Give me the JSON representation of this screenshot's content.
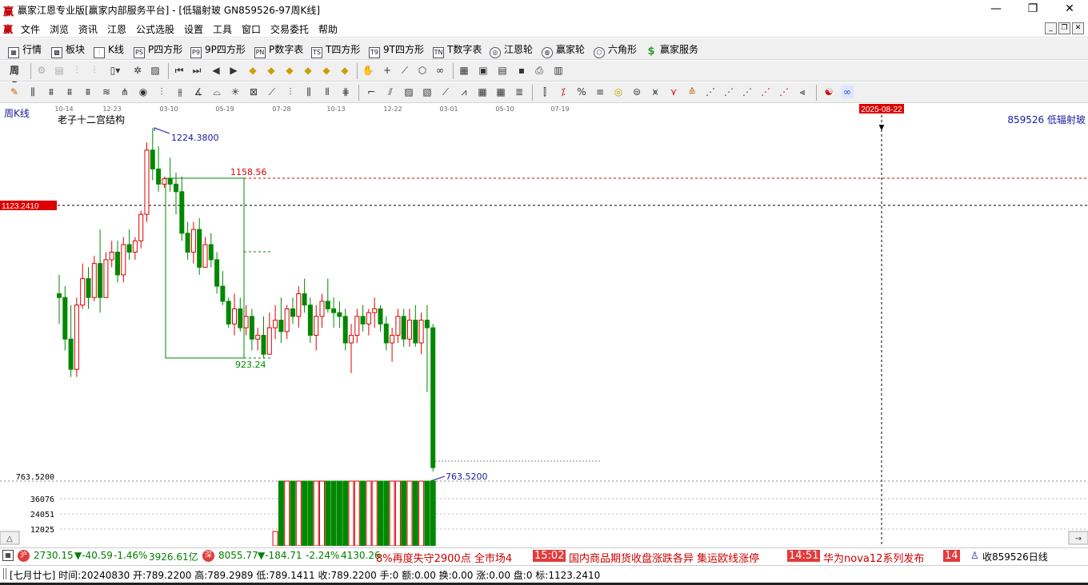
{
  "window": {
    "logo_char": "赢",
    "title": "赢家江恩专业版[赢家内部服务平台] - [低辐射玻  GN859526-97周K线]",
    "minimize": "—",
    "maximize": "❐",
    "close": "✕"
  },
  "menu": {
    "logo_char": "赢",
    "items": [
      "文件",
      "浏览",
      "资讯",
      "江恩",
      "公式选股",
      "设置",
      "工具",
      "窗口",
      "交易委托",
      "帮助"
    ]
  },
  "toolbar1": {
    "items": [
      {
        "icon": "grid-icon",
        "glyph": "▦",
        "label": "行情"
      },
      {
        "icon": "blocks-icon",
        "glyph": "▩",
        "label": "板块"
      },
      {
        "icon": "candlestick-icon",
        "glyph": "⫶",
        "label": "K线"
      },
      {
        "icon": "p-square-icon",
        "glyph": "PS",
        "label": "P四方形"
      },
      {
        "icon": "9p-square-icon",
        "glyph": "P9",
        "label": "9P四方形"
      },
      {
        "icon": "p-number-table-icon",
        "glyph": "PN",
        "label": "P数字表"
      },
      {
        "icon": "t-square-icon",
        "glyph": "TS",
        "label": "T四方形"
      },
      {
        "icon": "9t-square-icon",
        "glyph": "T9",
        "label": "9T四方形"
      },
      {
        "icon": "t-number-table-icon",
        "glyph": "TN",
        "label": "T数字表"
      },
      {
        "icon": "gann-wheel-icon",
        "glyph": "◎",
        "label": "江恩轮"
      },
      {
        "icon": "winner-wheel-icon",
        "glyph": "◍",
        "label": "赢家轮"
      },
      {
        "icon": "hexagon-icon",
        "glyph": "⬡",
        "label": "六角形"
      },
      {
        "icon": "dollar-icon",
        "glyph": "$",
        "label": "赢家服务"
      }
    ]
  },
  "chart": {
    "period_label": "周K线",
    "structure_label": "老子十二宫结构",
    "stock_info": "859526  低辐射玻",
    "time_ticks": [
      "10-14",
      "12-23",
      "03-10",
      "05-19",
      "07-28",
      "10-13",
      "12-22",
      "03-01",
      "05-10",
      "07-19"
    ],
    "cursor_date": "2025-08-22",
    "high_label": "1224.3800",
    "box_top_label": "1158.56",
    "box_bottom_label": "923.24",
    "current_price_label": "1123.2410",
    "low_label": "763.5200",
    "axis_low_label": "763.5200",
    "volume_ticks": [
      "36076",
      "24051",
      "12025"
    ],
    "colors": {
      "up": "#dd0000",
      "down": "#008800",
      "box": "#008800",
      "dashed_red": "#dd0000",
      "label_blue": "#1a1aa0"
    }
  },
  "chart_data": {
    "type": "candlestick",
    "title": "老子十二宫结构",
    "period": "周K线",
    "x_tick_labels": [
      "10-14",
      "12-23",
      "03-10",
      "05-19",
      "07-28",
      "10-13",
      "12-22",
      "03-01",
      "05-10",
      "07-19"
    ],
    "annotations": {
      "high": 1224.38,
      "box_top": 1158.56,
      "box_bottom": 923.24,
      "current_price": 1123.241,
      "low": 763.52
    },
    "volume_axis_ticks": [
      36076,
      24051,
      12025
    ],
    "candles": [
      [
        1005,
        1030,
        965,
        1000
      ],
      [
        1000,
        1015,
        930,
        945
      ],
      [
        945,
        990,
        895,
        905
      ],
      [
        905,
        1000,
        895,
        990
      ],
      [
        990,
        1045,
        985,
        1025
      ],
      [
        1025,
        1040,
        985,
        1000
      ],
      [
        1000,
        1055,
        995,
        1045
      ],
      [
        1045,
        1090,
        980,
        1000
      ],
      [
        1000,
        1060,
        1000,
        1050
      ],
      [
        1050,
        1075,
        1040,
        1060
      ],
      [
        1060,
        1075,
        1020,
        1030
      ],
      [
        1030,
        1080,
        1020,
        1070
      ],
      [
        1070,
        1090,
        1050,
        1060
      ],
      [
        1060,
        1080,
        1050,
        1075
      ],
      [
        1075,
        1115,
        1065,
        1110
      ],
      [
        1110,
        1205,
        1100,
        1195
      ],
      [
        1195,
        1224,
        1155,
        1170
      ],
      [
        1170,
        1200,
        1140,
        1150
      ],
      [
        1150,
        1160,
        1145,
        1157
      ],
      [
        1157,
        1185,
        1140,
        1150
      ],
      [
        1150,
        1165,
        1110,
        1140
      ],
      [
        1140,
        1160,
        1075,
        1085
      ],
      [
        1085,
        1100,
        1050,
        1060
      ],
      [
        1060,
        1100,
        1045,
        1090
      ],
      [
        1090,
        1105,
        1030,
        1040
      ],
      [
        1040,
        1080,
        1040,
        1070
      ],
      [
        1070,
        1085,
        1040,
        1050
      ],
      [
        1050,
        1060,
        1005,
        1015
      ],
      [
        1015,
        1035,
        990,
        995
      ],
      [
        995,
        1000,
        960,
        965
      ],
      [
        965,
        1005,
        950,
        985
      ],
      [
        985,
        1000,
        955,
        960
      ],
      [
        960,
        990,
        950,
        975
      ],
      [
        975,
        985,
        930,
        945
      ],
      [
        945,
        960,
        930,
        950
      ],
      [
        950,
        975,
        920,
        925
      ],
      [
        925,
        980,
        925,
        960
      ],
      [
        960,
        990,
        945,
        970
      ],
      [
        970,
        1000,
        940,
        955
      ],
      [
        955,
        990,
        945,
        985
      ],
      [
        985,
        1000,
        965,
        975
      ],
      [
        975,
        1015,
        960,
        1005
      ],
      [
        1005,
        1025,
        980,
        990
      ],
      [
        990,
        1000,
        940,
        950
      ],
      [
        950,
        990,
        930,
        975
      ],
      [
        975,
        1005,
        960,
        995
      ],
      [
        995,
        1025,
        980,
        985
      ],
      [
        985,
        1000,
        960,
        980
      ],
      [
        980,
        995,
        960,
        975
      ],
      [
        975,
        985,
        930,
        940
      ],
      [
        940,
        965,
        900,
        950
      ],
      [
        950,
        985,
        940,
        975
      ],
      [
        975,
        990,
        955,
        965
      ],
      [
        965,
        985,
        950,
        980
      ],
      [
        980,
        1000,
        960,
        985
      ],
      [
        985,
        990,
        955,
        965
      ],
      [
        965,
        975,
        930,
        940
      ],
      [
        940,
        960,
        915,
        950
      ],
      [
        950,
        985,
        940,
        975
      ],
      [
        975,
        985,
        935,
        945
      ],
      [
        945,
        985,
        935,
        970
      ],
      [
        970,
        990,
        935,
        940
      ],
      [
        940,
        980,
        925,
        970
      ],
      [
        970,
        990,
        875,
        960
      ],
      [
        960,
        965,
        770,
        775
      ]
    ]
  },
  "status": {
    "index1_badge": "沪",
    "index1_value": "2730.15",
    "index1_change": "▼-40.59",
    "index1_pct": "-1.46%",
    "index1_amount": "3926.61亿",
    "index2_badge": "深",
    "index2_value": "8055.77",
    "index2_change": "▼-184.71",
    "index2_pct": "-2.24%",
    "index2_amount": "4130.26",
    "news": [
      {
        "time": "",
        "text": "8%再度失守2900点 全市场4"
      },
      {
        "time": "15:02",
        "text": "国内商品期货收盘涨跌各异 集运欧线涨停"
      },
      {
        "time": "14:51",
        "text": "华为nova12系列发布"
      },
      {
        "time": "14",
        "text": ""
      }
    ],
    "right_text": "收859526日线"
  },
  "info": {
    "text": "[七月廿七] 时间:20240830 开:789.2200 高:789.2989 低:789.1411 收:789.2200 手:0 额:0.00 换:0.00 涨:0.00 盘:0 标:1123.2410"
  }
}
